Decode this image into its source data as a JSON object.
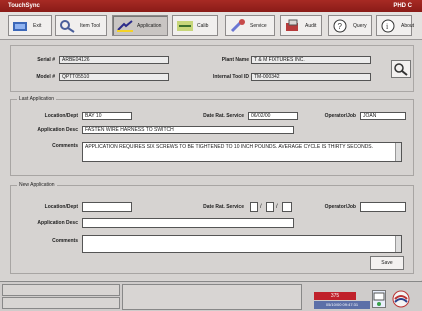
{
  "titlebar": {
    "title": "TouchSync",
    "right": "PHD C"
  },
  "toolbar": [
    {
      "label": "Exit",
      "icon": "exit-icon"
    },
    {
      "label": "Item Tool",
      "icon": "item-tool-icon"
    },
    {
      "label": "Application",
      "icon": "application-icon",
      "active": true
    },
    {
      "label": "Calib",
      "icon": "calib-icon"
    },
    {
      "label": "Service",
      "icon": "service-icon"
    },
    {
      "label": "Audit",
      "icon": "audit-icon"
    },
    {
      "label": "Query",
      "icon": "query-icon"
    },
    {
      "label": "About",
      "icon": "about-icon"
    }
  ],
  "header": {
    "serial_label": "Serial #",
    "serial_value": "ARBE04126",
    "model_label": "Model #",
    "model_value": "QPTT05510",
    "plant_label": "Plant Name",
    "plant_value": "T & M FIXTURES INC.",
    "internal_label": "Internal Tool ID",
    "internal_value": "TM-000342"
  },
  "last_application": {
    "legend": "Last Application",
    "location_label": "Location/Dept",
    "location_value": "BAY 10",
    "date_label": "Date Rat. Service",
    "date_value": "06/02/00",
    "operator_label": "Operator/Job",
    "operator_value": "JOAN",
    "desc_label": "Application Desc",
    "desc_value": "FASTEN WIRE HARNESS TO SWITCH",
    "comments_label": "Comments",
    "comments_value": "APPLICATION REQUIRES SIX SCREWS TO BE TIGHTENED TO 10 INCH POUNDS. AVERAGE CYCLE IS THIRTY SECONDS."
  },
  "new_application": {
    "legend": "New Application",
    "location_label": "Location/Dept",
    "date_label": "Date Rat. Service",
    "date_sep1": "/",
    "date_sep2": "/",
    "operator_label": "Operator/Job",
    "desc_label": "Application Desc",
    "comments_label": "Comments",
    "save_label": "Save"
  },
  "status": {
    "badge": "375",
    "timestamp": "05/10/00 09:47:31"
  }
}
